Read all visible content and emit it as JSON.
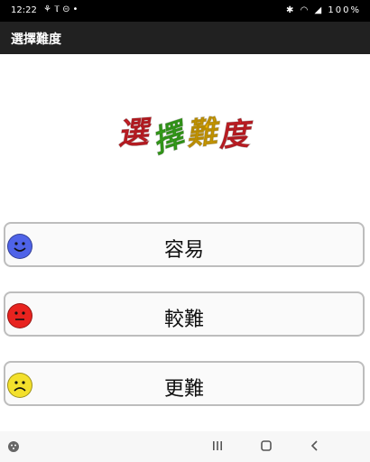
{
  "status_bar": {
    "time": "12:22",
    "icons": [
      "notification-icon",
      "antenna-icon",
      "record-icon",
      "dot-icon"
    ],
    "battery": "100%"
  },
  "app_bar": {
    "title": "選擇難度"
  },
  "logo": {
    "chars": [
      "選",
      "擇",
      "難",
      "度"
    ],
    "colors": [
      "#e8232b",
      "#3fbf1f",
      "#f3b800",
      "#e8232b"
    ]
  },
  "levels": [
    {
      "label": "容易",
      "face": "smile",
      "color": "#4f63e8"
    },
    {
      "label": "較難",
      "face": "neutral",
      "color": "#e8231f"
    },
    {
      "label": "更難",
      "face": "sad",
      "color": "#f3e02c"
    }
  ],
  "nav_bar": {
    "buttons": [
      "recent-apps",
      "home",
      "back"
    ]
  }
}
